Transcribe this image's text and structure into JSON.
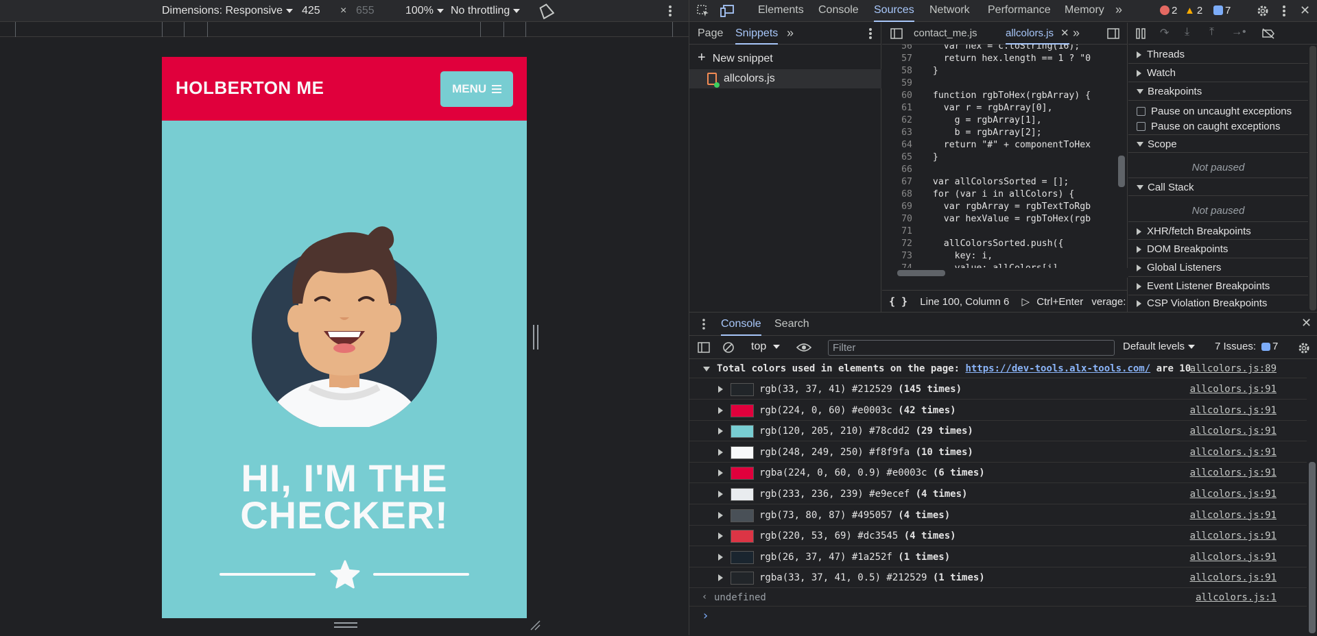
{
  "device_toolbar": {
    "dimensions_label": "Dimensions: Responsive",
    "width": "425",
    "times": "×",
    "height": "655",
    "zoom": "100%",
    "throttling": "No throttling"
  },
  "site": {
    "brand": "HOLBERTON ME",
    "menu_label": "MENU",
    "hero_line1": "HI, I'M THE",
    "hero_line2": "CHECKER!"
  },
  "devtools_tabs": [
    "Elements",
    "Console",
    "Sources",
    "Network",
    "Performance",
    "Memory"
  ],
  "active_tab": "Sources",
  "counters": {
    "errors": "2",
    "warnings": "2",
    "messages": "7"
  },
  "sources": {
    "nav_tabs": [
      "Page",
      "Snippets"
    ],
    "new_snippet": "New snippet",
    "snippet_file": "allcolors.js",
    "editor_tabs": [
      "contact_me.js",
      "allcolors.js"
    ],
    "status": "Line 100, Column 6",
    "run_hint": "Ctrl+Enter",
    "status_extra": "verage: n",
    "code_lines": [
      {
        "n": "56",
        "t": "    var hex = c.toString(16);"
      },
      {
        "n": "57",
        "t": "    return hex.length == 1 ? \"0"
      },
      {
        "n": "58",
        "t": "  }"
      },
      {
        "n": "59",
        "t": ""
      },
      {
        "n": "60",
        "t": "  function rgbToHex(rgbArray) {"
      },
      {
        "n": "61",
        "t": "    var r = rgbArray[0],"
      },
      {
        "n": "62",
        "t": "      g = rgbArray[1],"
      },
      {
        "n": "63",
        "t": "      b = rgbArray[2];"
      },
      {
        "n": "64",
        "t": "    return \"#\" + componentToHex"
      },
      {
        "n": "65",
        "t": "  }"
      },
      {
        "n": "66",
        "t": ""
      },
      {
        "n": "67",
        "t": "  var allColorsSorted = [];"
      },
      {
        "n": "68",
        "t": "  for (var i in allColors) {"
      },
      {
        "n": "69",
        "t": "    var rgbArray = rgbTextToRgb"
      },
      {
        "n": "70",
        "t": "    var hexValue = rgbToHex(rgb"
      },
      {
        "n": "71",
        "t": ""
      },
      {
        "n": "72",
        "t": "    allColorsSorted.push({"
      },
      {
        "n": "73",
        "t": "      key: i,"
      },
      {
        "n": "74",
        "t": "      value: allColors[i],"
      }
    ]
  },
  "debugger": {
    "sections_top": [
      "Threads",
      "Watch"
    ],
    "breakpoints": "Breakpoints",
    "pause_uncaught": "Pause on uncaught exceptions",
    "pause_caught": "Pause on caught exceptions",
    "scope": "Scope",
    "not_paused": "Not paused",
    "call_stack": "Call Stack",
    "sections_bottom": [
      "XHR/fetch Breakpoints",
      "DOM Breakpoints",
      "Global Listeners",
      "Event Listener Breakpoints",
      "CSP Violation Breakpoints"
    ]
  },
  "drawer": {
    "tabs": [
      "Console",
      "Search"
    ],
    "context": "top",
    "filter_placeholder": "Filter",
    "levels": "Default levels",
    "issues_label": "7 Issues:",
    "issues_count": "7"
  },
  "console": {
    "group_prefix": "Total colors used in elements on the page: ",
    "group_link": "https://dev-tools.alx-tools.com/",
    "group_suffix": " are 10",
    "group_src": "allcolors.js:89",
    "rows": [
      {
        "swatch": "#212529",
        "text": "rgb(33, 37, 41) #212529 ",
        "count": "(145 times)",
        "src": "allcolors.js:91"
      },
      {
        "swatch": "#e0003c",
        "text": "rgb(224, 0, 60) #e0003c ",
        "count": "(42 times)",
        "src": "allcolors.js:91"
      },
      {
        "swatch": "#78cdd2",
        "text": "rgb(120, 205, 210) #78cdd2 ",
        "count": "(29 times)",
        "src": "allcolors.js:91"
      },
      {
        "swatch": "#f8f9fa",
        "text": "rgb(248, 249, 250) #f8f9fa ",
        "count": "(10 times)",
        "src": "allcolors.js:91"
      },
      {
        "swatch": "#e0003c",
        "text": "rgba(224, 0, 60, 0.9) #e0003c ",
        "count": "(6 times)",
        "src": "allcolors.js:91"
      },
      {
        "swatch": "#e9ecef",
        "text": "rgb(233, 236, 239) #e9ecef ",
        "count": "(4 times)",
        "src": "allcolors.js:91"
      },
      {
        "swatch": "#495057",
        "text": "rgb(73, 80, 87) #495057 ",
        "count": "(4 times)",
        "src": "allcolors.js:91"
      },
      {
        "swatch": "#dc3545",
        "text": "rgb(220, 53, 69) #dc3545 ",
        "count": "(4 times)",
        "src": "allcolors.js:91"
      },
      {
        "swatch": "#1a252f",
        "text": "rgb(26, 37, 47) #1a252f ",
        "count": "(1 times)",
        "src": "allcolors.js:91"
      },
      {
        "swatch": "#212529",
        "text": "rgba(33, 37, 41, 0.5) #212529 ",
        "count": "(1 times)",
        "src": "allcolors.js:91"
      }
    ],
    "result": "undefined",
    "result_src": "allcolors.js:1",
    "prompt": "›"
  },
  "colors": {
    "brand_red": "#e0003c",
    "brand_teal": "#78cdd2",
    "light": "#f8f9fa",
    "devtools_accent": "#a8c7fa"
  }
}
